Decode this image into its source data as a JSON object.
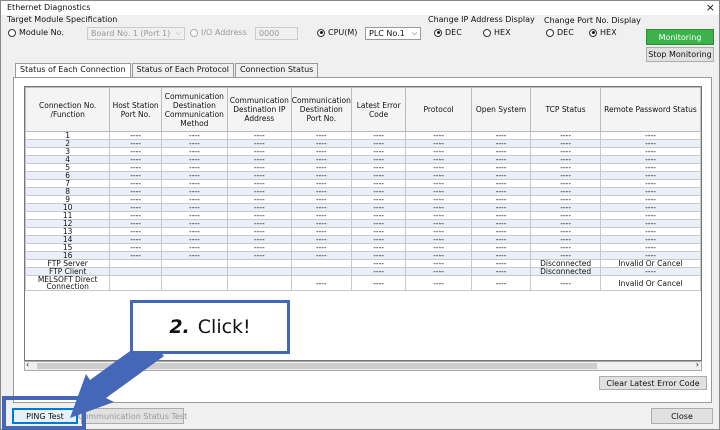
{
  "window": {
    "title": "Ethernet Diagnostics",
    "close": "×"
  },
  "target": {
    "label": "Target Module Specification",
    "module_no": "Module No.",
    "board": "Board No. 1 (Port 1)",
    "io_address": "I/O Address",
    "io_value": "0000",
    "cpu": "CPU(M)",
    "plc": "PLC No.1"
  },
  "ip_display": {
    "label": "Change IP Address Display",
    "dec": "DEC",
    "hex": "HEX"
  },
  "port_display": {
    "label": "Change Port No. Display",
    "dec": "DEC",
    "hex": "HEX"
  },
  "buttons": {
    "monitoring": "Monitoring",
    "stop": "Stop Monitoring",
    "clear": "Clear Latest Error Code",
    "ping": "PING Test",
    "comm_test": "Communication Status Test",
    "close": "Close"
  },
  "tabs": [
    "Status of Each Connection",
    "Status of Each Protocol",
    "Connection Status"
  ],
  "columns": [
    "Connection No. /Function",
    "Host Station Port No.",
    "Communication Destination Communication Method",
    "Communication Destination IP Address",
    "Communication Destination Port No.",
    "Latest Error Code",
    "Protocol",
    "Open System",
    "TCP Status",
    "Remote Password Status"
  ],
  "rows": [
    [
      "1",
      "----",
      "----",
      "----",
      "----",
      "----",
      "----",
      "----",
      "----",
      "----"
    ],
    [
      "2",
      "----",
      "----",
      "----",
      "----",
      "----",
      "----",
      "----",
      "----",
      "----"
    ],
    [
      "3",
      "----",
      "----",
      "----",
      "----",
      "----",
      "----",
      "----",
      "----",
      "----"
    ],
    [
      "4",
      "----",
      "----",
      "----",
      "----",
      "----",
      "----",
      "----",
      "----",
      "----"
    ],
    [
      "5",
      "----",
      "----",
      "----",
      "----",
      "----",
      "----",
      "----",
      "----",
      "----"
    ],
    [
      "6",
      "----",
      "----",
      "----",
      "----",
      "----",
      "----",
      "----",
      "----",
      "----"
    ],
    [
      "7",
      "----",
      "----",
      "----",
      "----",
      "----",
      "----",
      "----",
      "----",
      "----"
    ],
    [
      "8",
      "----",
      "----",
      "----",
      "----",
      "----",
      "----",
      "----",
      "----",
      "----"
    ],
    [
      "9",
      "----",
      "----",
      "----",
      "----",
      "----",
      "----",
      "----",
      "----",
      "----"
    ],
    [
      "10",
      "----",
      "----",
      "----",
      "----",
      "----",
      "----",
      "----",
      "----",
      "----"
    ],
    [
      "11",
      "----",
      "----",
      "----",
      "----",
      "----",
      "----",
      "----",
      "----",
      "----"
    ],
    [
      "12",
      "----",
      "----",
      "----",
      "----",
      "----",
      "----",
      "----",
      "----",
      "----"
    ],
    [
      "13",
      "----",
      "----",
      "----",
      "----",
      "----",
      "----",
      "----",
      "----",
      "----"
    ],
    [
      "14",
      "----",
      "----",
      "----",
      "----",
      "----",
      "----",
      "----",
      "----",
      "----"
    ],
    [
      "15",
      "----",
      "----",
      "----",
      "----",
      "----",
      "----",
      "----",
      "----",
      "----"
    ],
    [
      "16",
      "----",
      "----",
      "----",
      "----",
      "----",
      "----",
      "----",
      "----",
      "----"
    ],
    [
      "FTP Server",
      "",
      "",
      "",
      "",
      "----",
      "----",
      "----",
      "Disconnected",
      "Invalid Or Cancel"
    ],
    [
      "FTP Client",
      "",
      "",
      "",
      "",
      "----",
      "----",
      "----",
      "Disconnected",
      "----"
    ],
    [
      "MELSOFT Direct Connection",
      "",
      "",
      "",
      "----",
      "----",
      "----",
      "----",
      "----",
      "Invalid Or Cancel"
    ]
  ],
  "callout": {
    "step": "2.",
    "text": "Click!"
  },
  "colors": {
    "callout": "#4567b7",
    "monitoring": "#3bb34a"
  }
}
